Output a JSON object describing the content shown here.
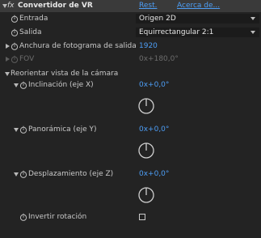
{
  "effect": {
    "fx_label": "fx",
    "name": "Convertidor de VR",
    "reset": "Rest.",
    "about": "Acerca de..."
  },
  "params": {
    "entrada": {
      "label": "Entrada",
      "value": "Origen 2D"
    },
    "salida": {
      "label": "Salida",
      "value": "Equirrectangular 2:1"
    },
    "anchura": {
      "label": "Anchura de fotograma de salida",
      "value": "1920"
    },
    "fov": {
      "label": "FOV",
      "value": "0x+180,0°"
    }
  },
  "reorient": {
    "label": "Reorientar vista de la cámara",
    "inclinacion": {
      "label": "Inclinación (eje X)",
      "value": "0x+0,0°"
    },
    "panoramica": {
      "label": "Panorámica (eje Y)",
      "value": "0x+0,0°"
    },
    "desplazamiento": {
      "label": "Desplazamiento (eje Z)",
      "value": "0x+0,0°"
    }
  },
  "invert": {
    "label": "Invertir rotación",
    "checked": false
  }
}
